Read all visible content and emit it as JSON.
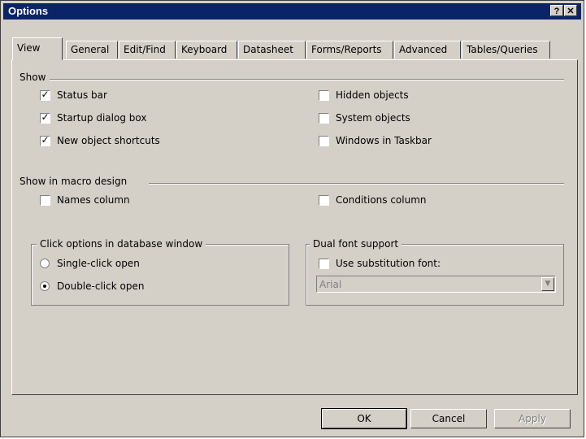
{
  "window": {
    "title": "Options",
    "help_button": "?",
    "close_button": "✕"
  },
  "tabs": [
    "View",
    "General",
    "Edit/Find",
    "Keyboard",
    "Datasheet",
    "Forms/Reports",
    "Advanced",
    "Tables/Queries"
  ],
  "active_tab": "View",
  "show_group": {
    "heading": "Show",
    "options": [
      {
        "label": "Status bar",
        "checked": true
      },
      {
        "label": "Startup dialog box",
        "checked": true
      },
      {
        "label": "New object shortcuts",
        "checked": true
      },
      {
        "label": "Hidden objects",
        "checked": false
      },
      {
        "label": "System objects",
        "checked": false
      },
      {
        "label": "Windows in Taskbar",
        "checked": false
      }
    ]
  },
  "macro_group": {
    "heading": "Show in macro design",
    "options": [
      {
        "label": "Names column",
        "checked": false
      },
      {
        "label": "Conditions column",
        "checked": false
      }
    ]
  },
  "click_group": {
    "heading": "Click options in database window",
    "options": [
      {
        "label": "Single-click open",
        "selected": false
      },
      {
        "label": "Double-click open",
        "selected": true
      }
    ]
  },
  "font_group": {
    "heading": "Dual font support",
    "substitution_label": "Use substitution font:",
    "substitution_checked": false,
    "font_value": "Arial"
  },
  "buttons": {
    "ok": "OK",
    "cancel": "Cancel",
    "apply": "Apply"
  },
  "icons": {
    "check": "✓",
    "dropdown": "▼"
  }
}
